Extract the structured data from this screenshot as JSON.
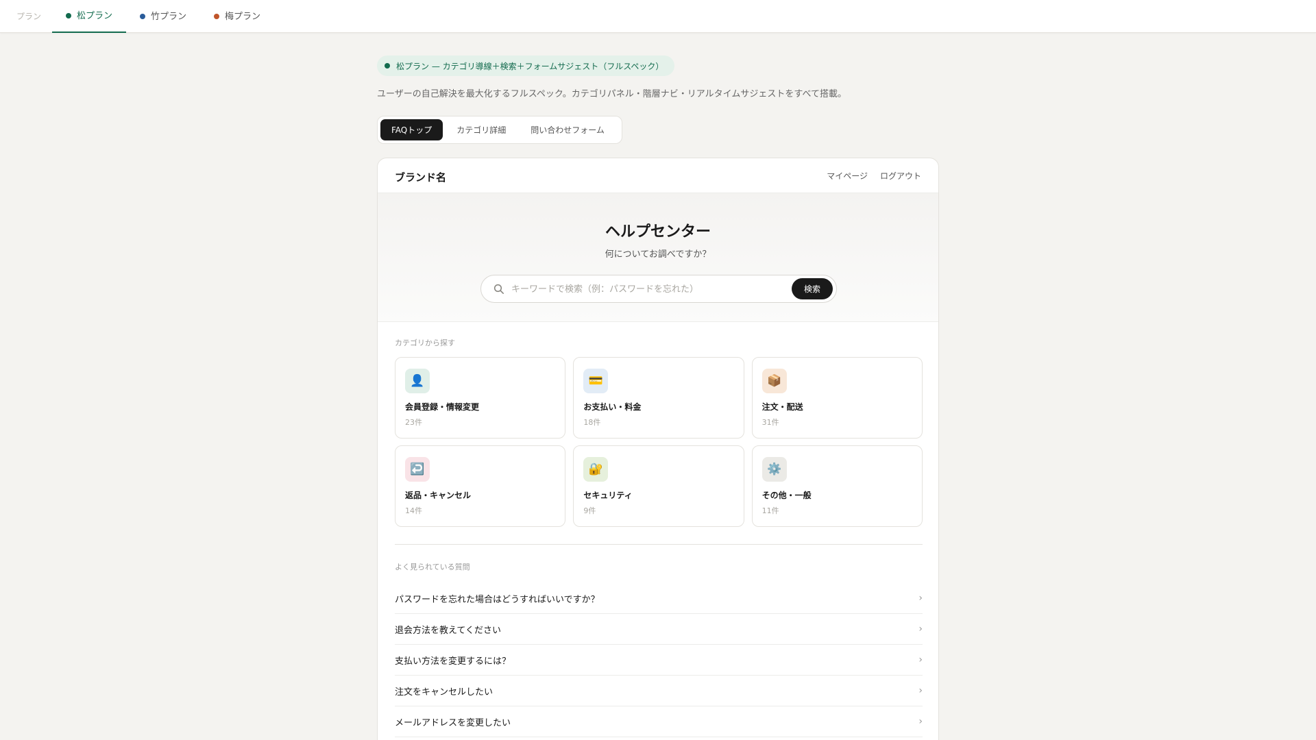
{
  "topbar": {
    "plan_label": "プラン",
    "tabs": [
      {
        "label": "松プラン",
        "color": "#136b4e",
        "active": true
      },
      {
        "label": "竹プラン",
        "color": "#2a5c9a",
        "active": false
      },
      {
        "label": "梅プラン",
        "color": "#c0552a",
        "active": false
      }
    ]
  },
  "plan_badge": "松プラン — カテゴリ導線＋検索＋フォームサジェスト（フルスペック）",
  "plan_desc": "ユーザーの自己解決を最大化するフルスペック。カテゴリパネル・階層ナビ・リアルタイムサジェストをすべて搭載。",
  "view_tabs": [
    {
      "label": "FAQトップ",
      "active": true
    },
    {
      "label": "カテゴリ詳細",
      "active": false
    },
    {
      "label": "問い合わせフォーム",
      "active": false
    }
  ],
  "header": {
    "brand": "ブランド名",
    "mypage": "マイページ",
    "logout": "ログアウト"
  },
  "hero": {
    "title": "ヘルプセンター",
    "subtitle": "何についてお調べですか？",
    "search_placeholder": "キーワードで検索（例：パスワードを忘れた）",
    "search_button": "検索"
  },
  "categories_title": "カテゴリから探す",
  "categories": [
    {
      "name": "会員登録・情報変更",
      "count": "23件",
      "icon": "👤",
      "icon_name": "user-icon",
      "bg": "#e0efe8"
    },
    {
      "name": "お支払い・料金",
      "count": "18件",
      "icon": "💳",
      "icon_name": "credit-card-icon",
      "bg": "#e2ecf6"
    },
    {
      "name": "注文・配送",
      "count": "31件",
      "icon": "📦",
      "icon_name": "package-icon",
      "bg": "#f8e7d8"
    },
    {
      "name": "返品・キャンセル",
      "count": "14件",
      "icon": "↩️",
      "icon_name": "return-icon",
      "bg": "#f9e3e7"
    },
    {
      "name": "セキュリティ",
      "count": "9件",
      "icon": "🔐",
      "icon_name": "lock-icon",
      "bg": "#e6f0dc"
    },
    {
      "name": "その他・一般",
      "count": "11件",
      "icon": "⚙️",
      "icon_name": "gear-icon",
      "bg": "#ebeae6"
    }
  ],
  "faq_title": "よく見られている質問",
  "faqs": [
    "パスワードを忘れた場合はどうすればいいですか？",
    "退会方法を教えてください",
    "支払い方法を変更するには？",
    "注文をキャンセルしたい",
    "メールアドレスを変更したい"
  ]
}
